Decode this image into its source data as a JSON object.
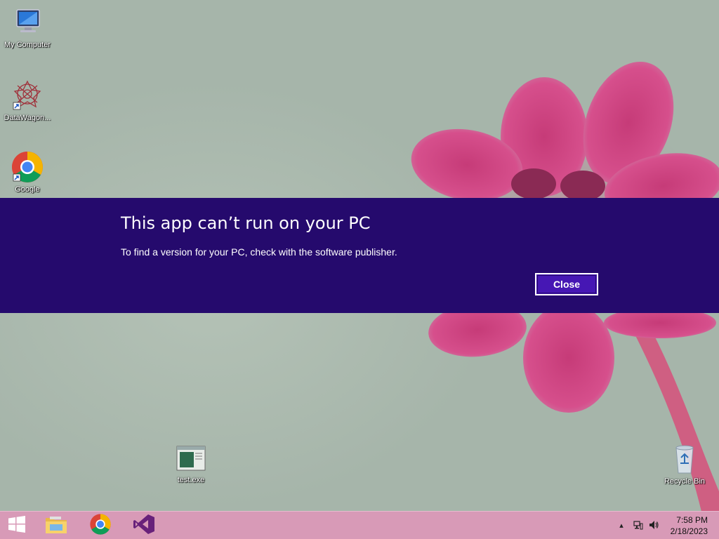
{
  "desktop": {
    "icons": [
      {
        "label": "My Computer",
        "icon": "computer-icon"
      },
      {
        "label": "DataWagon...",
        "icon": "datawagon-icon"
      },
      {
        "label": "Google",
        "icon": "chrome-icon"
      },
      {
        "label": "test.exe",
        "icon": "exe-file-icon"
      },
      {
        "label": "Recycle Bin",
        "icon": "recycle-bin-icon"
      }
    ]
  },
  "dialog": {
    "title": "This app can’t run on your PC",
    "message": "To find a version for your PC, check with the software publisher.",
    "close_label": "Close",
    "background_color": "#250a6d",
    "button_color": "#4617b4"
  },
  "taskbar": {
    "color": "#d89ab7",
    "pinned": [
      {
        "icon": "windows-start-icon"
      },
      {
        "icon": "file-explorer-icon"
      },
      {
        "icon": "chrome-icon"
      },
      {
        "icon": "visual-studio-icon"
      }
    ],
    "tray": {
      "icons": [
        "chevron-up-icon",
        "network-icon",
        "volume-icon"
      ],
      "time": "7:58 PM",
      "date": "2/18/2023"
    }
  }
}
